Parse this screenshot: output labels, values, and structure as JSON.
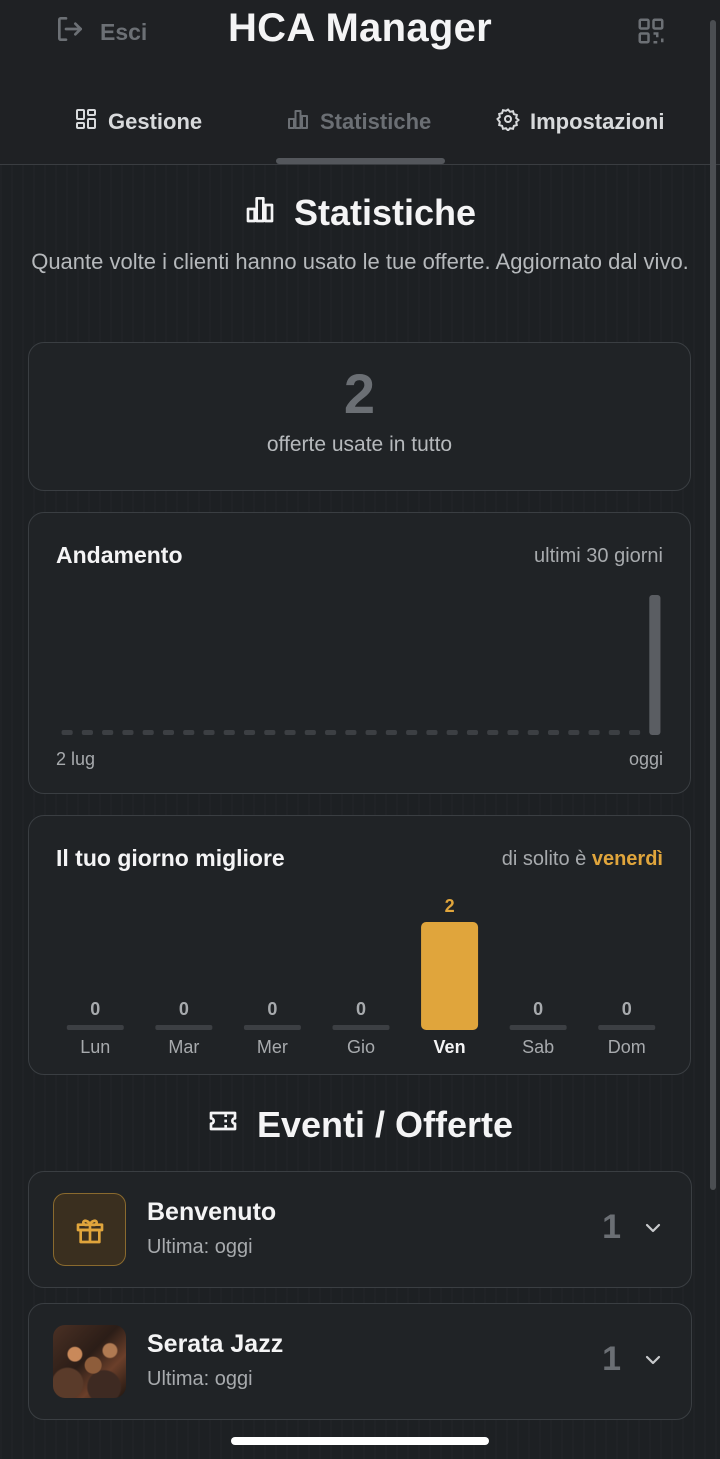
{
  "header": {
    "exit_label": "Esci",
    "app_title": "HCA Manager"
  },
  "tabs": [
    {
      "label": "Gestione",
      "icon": "grid-icon",
      "active": false
    },
    {
      "label": "Statistiche",
      "icon": "bar-chart-icon",
      "active": true
    },
    {
      "label": "Impostazioni",
      "icon": "gear-icon",
      "active": false
    }
  ],
  "stats": {
    "title": "Statistiche",
    "subtitle": "Quante volte i clienti hanno usato le tue offerte. Aggiornato dal vivo.",
    "total_value": "2",
    "total_label": "offerte usate in tutto"
  },
  "trend": {
    "title": "Andamento",
    "period": "ultimi 30 giorni",
    "start_label": "2 lug",
    "end_label": "oggi"
  },
  "best_day": {
    "title": "Il tuo giorno migliore",
    "note_prefix": "di solito è",
    "note_day": "venerdì"
  },
  "events": {
    "title": "Eventi / Offerte",
    "items": [
      {
        "name": "Benvenuto",
        "last": "Ultima: oggi",
        "count": "1",
        "thumb": "gift-icon"
      },
      {
        "name": "Serata Jazz",
        "last": "Ultima: oggi",
        "count": "1",
        "thumb": "jazz-photo"
      }
    ]
  },
  "colors": {
    "accent": "#e0a53c",
    "muted_bar": "#3c3f43",
    "trend_bar": "#5a5d62"
  },
  "chart_data": [
    {
      "type": "bar",
      "title": "Andamento",
      "categories_count": 30,
      "start_label": "2 lug",
      "end_label": "oggi",
      "values": [
        0,
        0,
        0,
        0,
        0,
        0,
        0,
        0,
        0,
        0,
        0,
        0,
        0,
        0,
        0,
        0,
        0,
        0,
        0,
        0,
        0,
        0,
        0,
        0,
        0,
        0,
        0,
        0,
        0,
        2
      ],
      "ylim": [
        0,
        2
      ]
    },
    {
      "type": "bar",
      "title": "Il tuo giorno migliore",
      "categories": [
        "Lun",
        "Mar",
        "Mer",
        "Gio",
        "Ven",
        "Sab",
        "Dom"
      ],
      "values": [
        0,
        0,
        0,
        0,
        2,
        0,
        0
      ],
      "highlight": "Ven",
      "ylim": [
        0,
        2
      ]
    }
  ]
}
